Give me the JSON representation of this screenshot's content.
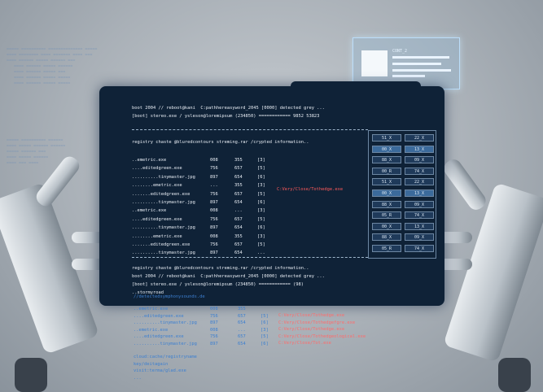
{
  "holo_card": {
    "title": "CONT_2"
  },
  "tablet": {
    "header": [
      "boot 2004 // reboot@kani  C:pathhereasyword_2045 [0000] detected grey ...",
      "[boot] stereo.exe / ysleson@loremipsum (234850) ============ 9852 53823"
    ],
    "section_title": "registry chaste @bluredcontours streming.rar /crypted information..",
    "files": [
      {
        "name": "..emetric.exe",
        "a": "008",
        "b": "355",
        "c": "[3]"
      },
      {
        "name": "....editedgreen.exe",
        "a": "756",
        "b": "657",
        "c": "[5]"
      },
      {
        "name": "..........tinymaster.jpg",
        "a": "897",
        "b": "654",
        "c": "[6]"
      },
      {
        "name": "........emetric.exe",
        "a": "...",
        "b": "355",
        "c": "[3]"
      },
      {
        "name": ".......editedgreen.exe",
        "a": "756",
        "b": "657",
        "c": "[5]"
      },
      {
        "name": "..........tinymaster.jpg",
        "a": "897",
        "b": "654",
        "c": "[6]"
      },
      {
        "name": "..emetric.exe",
        "a": "008",
        "b": "...",
        "c": "[3]"
      },
      {
        "name": "....editedgreen.exe",
        "a": "756",
        "b": "657",
        "c": "[5]"
      },
      {
        "name": "..........tinymaster.jpg",
        "a": "897",
        "b": "654",
        "c": "[6]"
      },
      {
        "name": "........emetric.exe",
        "a": "008",
        "b": "355",
        "c": "[3]"
      },
      {
        "name": ".......editedgreen.exe",
        "a": "756",
        "b": "657",
        "c": "[5]"
      },
      {
        "name": "..........tinymaster.jpg",
        "a": "897",
        "b": "654",
        "c": "..."
      }
    ],
    "red_path": "C:Very/Close/Tothedge.exe",
    "footer_title": "registry chaste @bluredcontours streming.rar /crypted information..",
    "footer": [
      "boot 2004 // reboot@kani  C:pathhereasyword_2045 [0000] detected grey ...",
      "[boot] stereo.exe / ysleson@loremipsum (234850) ============ (98)",
      "..stormyroad"
    ],
    "grid": [
      [
        "51_X",
        "22_X"
      ],
      [
        "00_X",
        "13_X"
      ],
      [
        "88_X",
        "09_X"
      ],
      [
        "00_R",
        "74_X"
      ],
      [
        "51_X",
        "22_X"
      ],
      [
        "00_X",
        "13_X"
      ],
      [
        "88_X",
        "09_X"
      ],
      [
        "05_R",
        "74_X"
      ],
      [
        "00_X",
        "13_X"
      ],
      [
        "88_X",
        "09_X"
      ],
      [
        "05_R",
        "74_X"
      ]
    ]
  },
  "holo_lower": {
    "intro": "//detectedsymphonysounds.de",
    "rows": [
      {
        "name": "..emetric.exe",
        "a": "008",
        "b": "355"
      },
      {
        "name": "....editedgreen.exe",
        "a": "756",
        "b": "657",
        "c": "[5]"
      },
      {
        "name": "..........tinymaster.jpg",
        "a": "897",
        "b": "654",
        "c": "[6]"
      },
      {
        "name": "..emetric.exe",
        "a": "008",
        "b": "...",
        "c": "[3]"
      },
      {
        "name": "....editedgreen.exe",
        "a": "756",
        "b": "657",
        "c": "[5]"
      },
      {
        "name": "..........tinymaster.jpg",
        "a": "897",
        "b": "654",
        "c": "[6]"
      }
    ],
    "red": [
      "C:Very/Close/Tothedge.exe",
      "C:Very/Close/Tothedgefgre.exe",
      "C:Very/Close/Tothedge.exe",
      "C:Very/Close/Tothedgeological.exe",
      "C:Very/Close/Tot.exe"
    ],
    "tail": [
      "cloud:cache/registryname",
      "key/deitagain",
      "visit:terma/glad.exe",
      "..."
    ]
  },
  "colors": {
    "terminal_bg": "#0f2237",
    "accent_red": "#ff5a5a",
    "holo_blue": "#3c7fd0"
  }
}
